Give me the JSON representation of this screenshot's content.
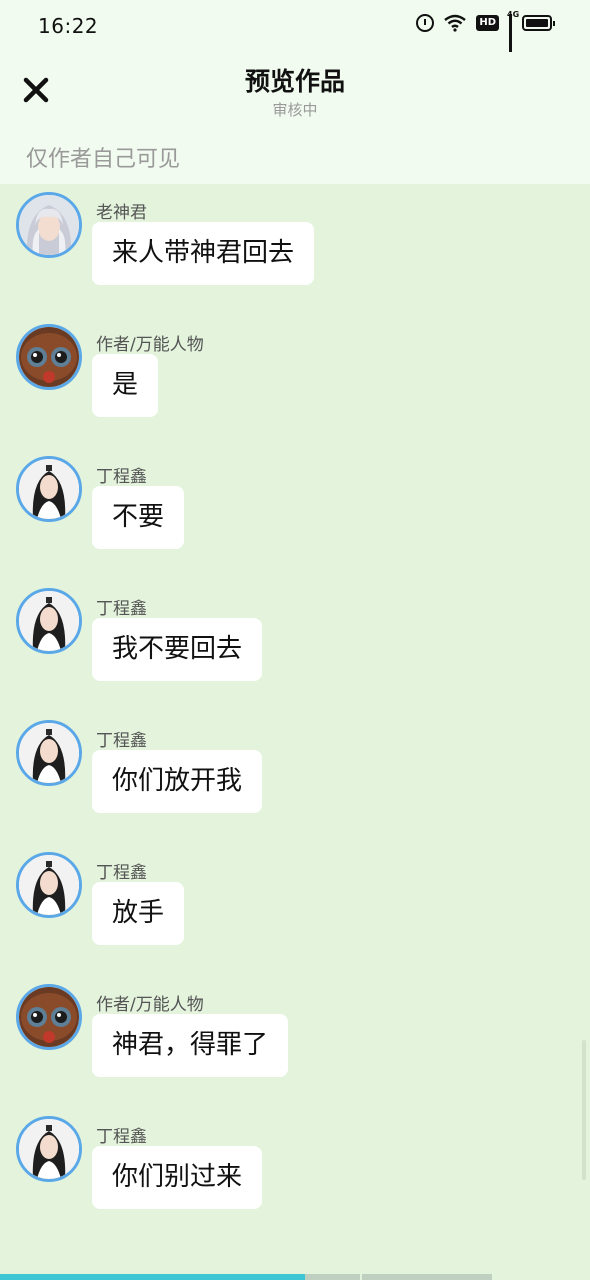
{
  "status_bar": {
    "time": "16:22",
    "icons": [
      "alarm-icon",
      "wifi-icon",
      "hd-icon",
      "signal-4g-icon",
      "battery-icon"
    ],
    "hd_label": "HD",
    "network_label": "4G"
  },
  "header": {
    "close_icon": "close-icon",
    "title": "预览作品",
    "subtitle": "审核中",
    "visibility_note": "仅作者自己可见"
  },
  "colors": {
    "chat_background": "#e3f3dc",
    "header_background": "#f1fbef",
    "bubble": "#ffffff",
    "avatar_border": "#5aa8e8",
    "progress_accent": "#3fc6d4"
  },
  "messages": [
    {
      "sender": "老神君",
      "avatar": "elder-avatar",
      "text": "来人带神君回去"
    },
    {
      "sender": "作者/万能人物",
      "avatar": "author-avatar",
      "text": "是"
    },
    {
      "sender": "丁程鑫",
      "avatar": "character-avatar",
      "text": "不要"
    },
    {
      "sender": "丁程鑫",
      "avatar": "character-avatar",
      "text": "我不要回去"
    },
    {
      "sender": "丁程鑫",
      "avatar": "character-avatar",
      "text": "你们放开我"
    },
    {
      "sender": "丁程鑫",
      "avatar": "character-avatar",
      "text": "放手"
    },
    {
      "sender": "作者/万能人物",
      "avatar": "author-avatar",
      "text": "神君，得罪了"
    },
    {
      "sender": "丁程鑫",
      "avatar": "character-avatar",
      "text": "你们别过来"
    }
  ]
}
